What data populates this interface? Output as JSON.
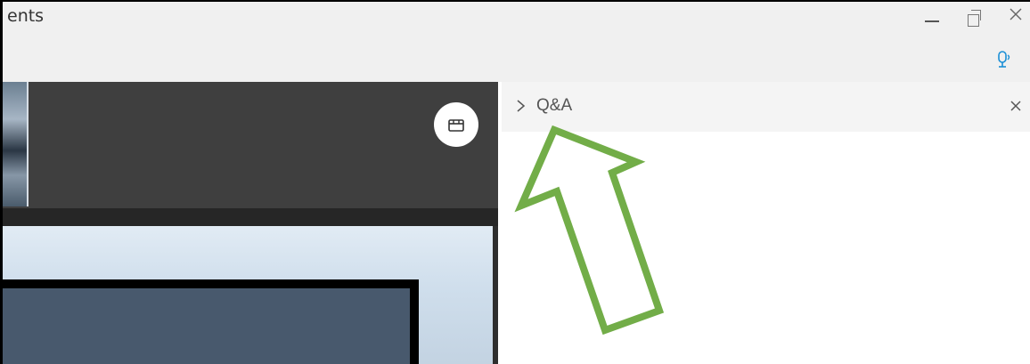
{
  "window": {
    "title": "ents",
    "controls": [
      "minimize-icon",
      "maximize-icon",
      "close-icon"
    ]
  },
  "toolbar": {
    "mic_icon": "microphone-icon"
  },
  "video": {
    "capture_button_icon": "camera-capture-icon"
  },
  "qa_panel": {
    "title": "Q&A",
    "expand_icon": "chevron-right-icon",
    "close_icon": "close-icon"
  },
  "annotation": {
    "arrow_icon": "arrow-up-icon",
    "arrow_color": "#72ad48"
  },
  "colors": {
    "titlebar_bg": "#f0f0f0",
    "video_bg": "#3f3f3f",
    "qa_header_bg": "#f4f4f4",
    "accent_blue": "#1a8fd6"
  }
}
